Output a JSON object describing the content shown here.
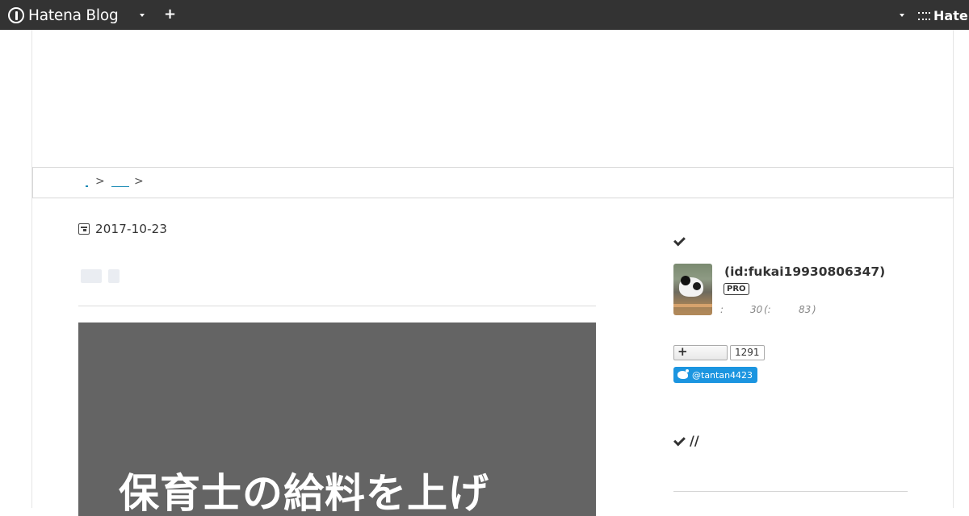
{
  "global_header": {
    "logo_text": "Hatena Blog",
    "hatena_label": "Hatena"
  },
  "article": {
    "date": "2017-10-23",
    "eyecatch_title": "保育士の給料を上げ"
  },
  "sidebar": {
    "user_name": "(id:fukai19930806347)",
    "pro_badge": "PRO",
    "readers_colon": ":",
    "readers_count": "30",
    "readers_open": "(:",
    "readers_total": "83",
    "readers_close": ")",
    "follow_count": "1291",
    "twitter_handle": "@tantan4423",
    "section_heading": "//"
  },
  "breadcrumb": {
    "separator": ">"
  },
  "colors": {
    "header_bg": "#333333",
    "link": "#1a8ab5",
    "eyecatch_bg": "#646464",
    "twitter": "#1b95e0"
  }
}
